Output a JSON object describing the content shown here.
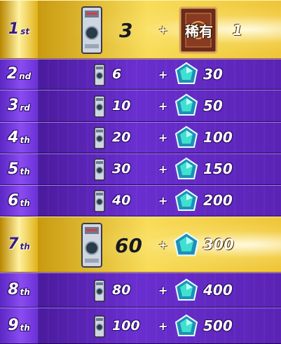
{
  "ranks": [
    {
      "num": "1",
      "suffix": "st"
    },
    {
      "num": "2",
      "suffix": "nd"
    },
    {
      "num": "3",
      "suffix": "rd"
    },
    {
      "num": "4",
      "suffix": "th"
    },
    {
      "num": "5",
      "suffix": "th"
    },
    {
      "num": "6",
      "suffix": "th"
    },
    {
      "num": "7",
      "suffix": "th"
    },
    {
      "num": "8",
      "suffix": "th"
    },
    {
      "num": "9",
      "suffix": "th"
    }
  ],
  "rewards": [
    {
      "card_qty": "3",
      "plus": "+",
      "bonus_label": "稀有",
      "bonus_qty": "1",
      "bonus_type": "rare-pack"
    },
    {
      "card_qty": "6",
      "plus": "+",
      "bonus_qty": "30",
      "bonus_type": "gem"
    },
    {
      "card_qty": "10",
      "plus": "+",
      "bonus_qty": "50",
      "bonus_type": "gem"
    },
    {
      "card_qty": "20",
      "plus": "+",
      "bonus_qty": "100",
      "bonus_type": "gem"
    },
    {
      "card_qty": "30",
      "plus": "+",
      "bonus_qty": "150",
      "bonus_type": "gem"
    },
    {
      "card_qty": "40",
      "plus": "+",
      "bonus_qty": "200",
      "bonus_type": "gem"
    },
    {
      "card_qty": "60",
      "plus": "+",
      "bonus_qty": "300",
      "bonus_type": "gem"
    },
    {
      "card_qty": "80",
      "plus": "+",
      "bonus_qty": "400",
      "bonus_type": "gem"
    },
    {
      "card_qty": "100",
      "plus": "+",
      "bonus_qty": "500",
      "bonus_type": "gem"
    }
  ],
  "icons": {
    "card": "card-pack-icon",
    "gem": "gem-icon",
    "rare": "rare-card-icon"
  },
  "colors": {
    "gold": "#f2cf3c",
    "purple": "#6a2fd0",
    "gem_teal": "#2fd6c8"
  }
}
